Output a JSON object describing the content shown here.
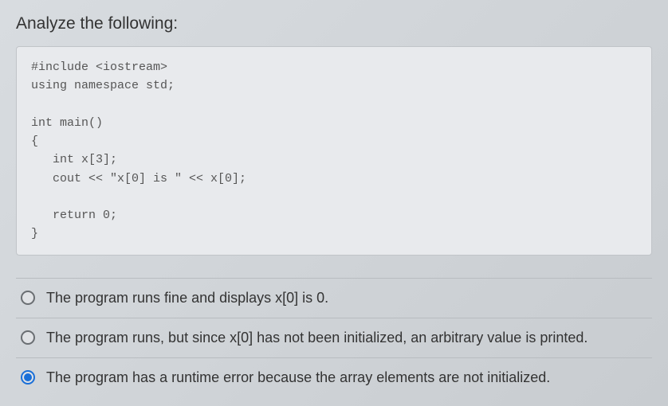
{
  "question": {
    "prompt": "Analyze the following:",
    "code": "#include <iostream>\nusing namespace std;\n\nint main()\n{\n   int x[3];\n   cout << \"x[0] is \" << x[0];\n\n   return 0;\n}"
  },
  "options": [
    {
      "label": "The program runs fine and displays x[0] is 0.",
      "selected": false
    },
    {
      "label": "The program runs, but since x[0] has not been initialized, an arbitrary value is printed.",
      "selected": false
    },
    {
      "label": "The program has a runtime error because the array elements are not initialized.",
      "selected": true
    }
  ]
}
